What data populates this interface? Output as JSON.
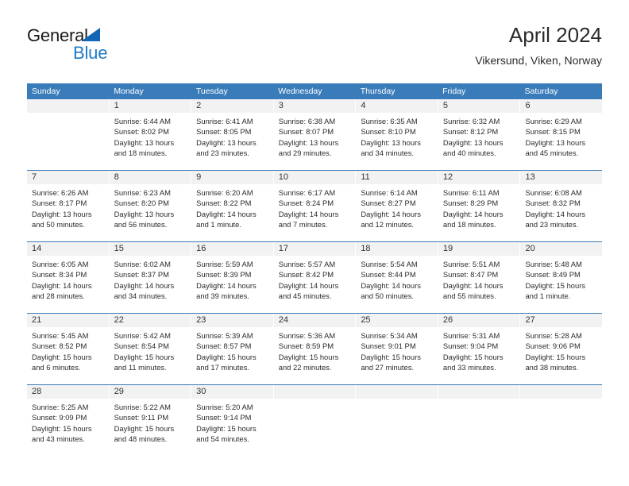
{
  "brand": {
    "name_top": "General",
    "name_bottom": "Blue",
    "colors": {
      "header_blue": "#3a7cba",
      "logo_blue": "#1f7ac4",
      "band_gray": "#f2f2f2"
    }
  },
  "header": {
    "title": "April 2024",
    "subtitle": "Vikersund, Viken, Norway"
  },
  "weekdays": [
    "Sunday",
    "Monday",
    "Tuesday",
    "Wednesday",
    "Thursday",
    "Friday",
    "Saturday"
  ],
  "weeks": [
    [
      {
        "day": "",
        "sunrise": "",
        "sunset": "",
        "daylight": ""
      },
      {
        "day": "1",
        "sunrise": "Sunrise: 6:44 AM",
        "sunset": "Sunset: 8:02 PM",
        "daylight": "Daylight: 13 hours and 18 minutes."
      },
      {
        "day": "2",
        "sunrise": "Sunrise: 6:41 AM",
        "sunset": "Sunset: 8:05 PM",
        "daylight": "Daylight: 13 hours and 23 minutes."
      },
      {
        "day": "3",
        "sunrise": "Sunrise: 6:38 AM",
        "sunset": "Sunset: 8:07 PM",
        "daylight": "Daylight: 13 hours and 29 minutes."
      },
      {
        "day": "4",
        "sunrise": "Sunrise: 6:35 AM",
        "sunset": "Sunset: 8:10 PM",
        "daylight": "Daylight: 13 hours and 34 minutes."
      },
      {
        "day": "5",
        "sunrise": "Sunrise: 6:32 AM",
        "sunset": "Sunset: 8:12 PM",
        "daylight": "Daylight: 13 hours and 40 minutes."
      },
      {
        "day": "6",
        "sunrise": "Sunrise: 6:29 AM",
        "sunset": "Sunset: 8:15 PM",
        "daylight": "Daylight: 13 hours and 45 minutes."
      }
    ],
    [
      {
        "day": "7",
        "sunrise": "Sunrise: 6:26 AM",
        "sunset": "Sunset: 8:17 PM",
        "daylight": "Daylight: 13 hours and 50 minutes."
      },
      {
        "day": "8",
        "sunrise": "Sunrise: 6:23 AM",
        "sunset": "Sunset: 8:20 PM",
        "daylight": "Daylight: 13 hours and 56 minutes."
      },
      {
        "day": "9",
        "sunrise": "Sunrise: 6:20 AM",
        "sunset": "Sunset: 8:22 PM",
        "daylight": "Daylight: 14 hours and 1 minute."
      },
      {
        "day": "10",
        "sunrise": "Sunrise: 6:17 AM",
        "sunset": "Sunset: 8:24 PM",
        "daylight": "Daylight: 14 hours and 7 minutes."
      },
      {
        "day": "11",
        "sunrise": "Sunrise: 6:14 AM",
        "sunset": "Sunset: 8:27 PM",
        "daylight": "Daylight: 14 hours and 12 minutes."
      },
      {
        "day": "12",
        "sunrise": "Sunrise: 6:11 AM",
        "sunset": "Sunset: 8:29 PM",
        "daylight": "Daylight: 14 hours and 18 minutes."
      },
      {
        "day": "13",
        "sunrise": "Sunrise: 6:08 AM",
        "sunset": "Sunset: 8:32 PM",
        "daylight": "Daylight: 14 hours and 23 minutes."
      }
    ],
    [
      {
        "day": "14",
        "sunrise": "Sunrise: 6:05 AM",
        "sunset": "Sunset: 8:34 PM",
        "daylight": "Daylight: 14 hours and 28 minutes."
      },
      {
        "day": "15",
        "sunrise": "Sunrise: 6:02 AM",
        "sunset": "Sunset: 8:37 PM",
        "daylight": "Daylight: 14 hours and 34 minutes."
      },
      {
        "day": "16",
        "sunrise": "Sunrise: 5:59 AM",
        "sunset": "Sunset: 8:39 PM",
        "daylight": "Daylight: 14 hours and 39 minutes."
      },
      {
        "day": "17",
        "sunrise": "Sunrise: 5:57 AM",
        "sunset": "Sunset: 8:42 PM",
        "daylight": "Daylight: 14 hours and 45 minutes."
      },
      {
        "day": "18",
        "sunrise": "Sunrise: 5:54 AM",
        "sunset": "Sunset: 8:44 PM",
        "daylight": "Daylight: 14 hours and 50 minutes."
      },
      {
        "day": "19",
        "sunrise": "Sunrise: 5:51 AM",
        "sunset": "Sunset: 8:47 PM",
        "daylight": "Daylight: 14 hours and 55 minutes."
      },
      {
        "day": "20",
        "sunrise": "Sunrise: 5:48 AM",
        "sunset": "Sunset: 8:49 PM",
        "daylight": "Daylight: 15 hours and 1 minute."
      }
    ],
    [
      {
        "day": "21",
        "sunrise": "Sunrise: 5:45 AM",
        "sunset": "Sunset: 8:52 PM",
        "daylight": "Daylight: 15 hours and 6 minutes."
      },
      {
        "day": "22",
        "sunrise": "Sunrise: 5:42 AM",
        "sunset": "Sunset: 8:54 PM",
        "daylight": "Daylight: 15 hours and 11 minutes."
      },
      {
        "day": "23",
        "sunrise": "Sunrise: 5:39 AM",
        "sunset": "Sunset: 8:57 PM",
        "daylight": "Daylight: 15 hours and 17 minutes."
      },
      {
        "day": "24",
        "sunrise": "Sunrise: 5:36 AM",
        "sunset": "Sunset: 8:59 PM",
        "daylight": "Daylight: 15 hours and 22 minutes."
      },
      {
        "day": "25",
        "sunrise": "Sunrise: 5:34 AM",
        "sunset": "Sunset: 9:01 PM",
        "daylight": "Daylight: 15 hours and 27 minutes."
      },
      {
        "day": "26",
        "sunrise": "Sunrise: 5:31 AM",
        "sunset": "Sunset: 9:04 PM",
        "daylight": "Daylight: 15 hours and 33 minutes."
      },
      {
        "day": "27",
        "sunrise": "Sunrise: 5:28 AM",
        "sunset": "Sunset: 9:06 PM",
        "daylight": "Daylight: 15 hours and 38 minutes."
      }
    ],
    [
      {
        "day": "28",
        "sunrise": "Sunrise: 5:25 AM",
        "sunset": "Sunset: 9:09 PM",
        "daylight": "Daylight: 15 hours and 43 minutes."
      },
      {
        "day": "29",
        "sunrise": "Sunrise: 5:22 AM",
        "sunset": "Sunset: 9:11 PM",
        "daylight": "Daylight: 15 hours and 48 minutes."
      },
      {
        "day": "30",
        "sunrise": "Sunrise: 5:20 AM",
        "sunset": "Sunset: 9:14 PM",
        "daylight": "Daylight: 15 hours and 54 minutes."
      },
      {
        "day": "",
        "sunrise": "",
        "sunset": "",
        "daylight": ""
      },
      {
        "day": "",
        "sunrise": "",
        "sunset": "",
        "daylight": ""
      },
      {
        "day": "",
        "sunrise": "",
        "sunset": "",
        "daylight": ""
      },
      {
        "day": "",
        "sunrise": "",
        "sunset": "",
        "daylight": ""
      }
    ]
  ]
}
